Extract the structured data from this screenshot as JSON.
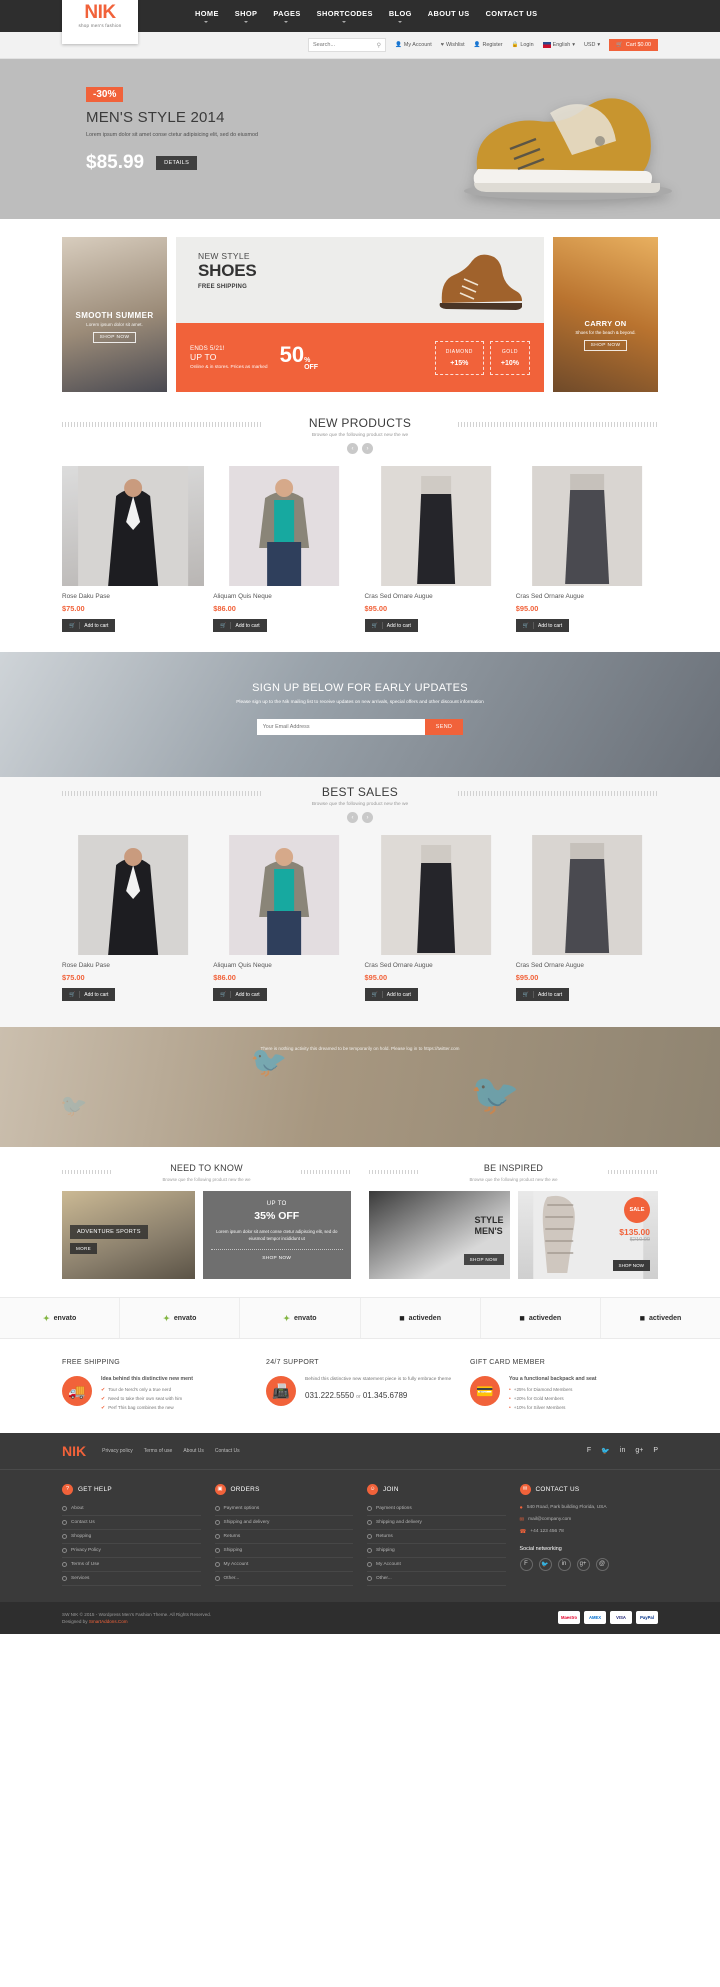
{
  "header": {
    "logo": "NIK",
    "logo_sub": "shop men's fashion",
    "nav": [
      {
        "label": "HOME",
        "caret": true
      },
      {
        "label": "SHOP",
        "caret": true
      },
      {
        "label": "PAGES",
        "caret": true
      },
      {
        "label": "SHORTCODES",
        "caret": true
      },
      {
        "label": "BLOG",
        "caret": true
      },
      {
        "label": "ABOUT US",
        "caret": false
      },
      {
        "label": "CONTACT US",
        "caret": false
      }
    ]
  },
  "utilitybar": {
    "search_placeholder": "Search...",
    "search_value": "",
    "search_icon": "search-icon",
    "my_account": "My Account",
    "wishlist": "Wishlist",
    "register": "Register",
    "login": "Login",
    "language": "English",
    "currency": "USD",
    "cart": "Cart $0.00"
  },
  "hero": {
    "badge": "-30%",
    "title": "MEN'S STYLE 2014",
    "desc": "Lorem ipsum dolor sit amet conse ctetur adipisicing elit, sed do eiusmod",
    "price": "$85.99",
    "button": "DETAILS"
  },
  "promos": {
    "left": {
      "title": "SMOOTH SUMMER",
      "sub": "Lorem ipsum dolor sit amet.",
      "cta": "SHOP NOW"
    },
    "mid": {
      "small": "NEW STYLE",
      "big": "SHOES",
      "shipping": "FREE SHIPPING",
      "ends": "ENDS 5/21!",
      "upto": "UP TO",
      "percent": "50",
      "pct_sym": "%",
      "off": "OFF",
      "fine": "Online & in stores. Prices as marked",
      "tiers": [
        {
          "name": "DIAMOND",
          "value": "+15%"
        },
        {
          "name": "GOLD",
          "value": "+10%"
        }
      ]
    },
    "right": {
      "title": "CARRY ON",
      "sub": "Shoes for the beach & beyond.",
      "cta": "SHOP NOW"
    }
  },
  "new_products": {
    "title": "NEW PRODUCTS",
    "subtitle": "Browse que the following product new the we",
    "prev": "‹",
    "next": "›",
    "add_to_cart": "Add to cart",
    "items": [
      {
        "name": "Rose Daku Pase",
        "price": "$75.00"
      },
      {
        "name": "Aliquam Quis Neque",
        "price": "$86.00"
      },
      {
        "name": "Cras Sed Ornare Augue",
        "price": "$95.00"
      },
      {
        "name": "Cras Sed Ornare Augue",
        "price": "$95.00"
      }
    ]
  },
  "newsletter": {
    "title": "SIGN UP BELOW FOR EARLY UPDATES",
    "desc": "Please sign up to the Nik mailing list to receive updates on new arrivals, special offers and other discount information",
    "placeholder": "Your Email Address",
    "value": "",
    "button": "SEND"
  },
  "best_sales": {
    "title": "BEST SALES",
    "subtitle": "Browse que the following product new the we",
    "prev": "‹",
    "next": "›",
    "add_to_cart": "Add to cart",
    "items": [
      {
        "name": "Rose Daku Pase",
        "price": "$75.00"
      },
      {
        "name": "Aliquam Quis Neque",
        "price": "$86.00"
      },
      {
        "name": "Cras Sed Ornare Augue",
        "price": "$95.00"
      },
      {
        "name": "Cras Sed Ornare Augue",
        "price": "$95.00"
      }
    ]
  },
  "twitter_strip": {
    "text": "There is nothing activity this dreamed to be temporarily on hold. Please log in to https://twitter.com"
  },
  "need_to_know": {
    "title": "NEED TO KNOW",
    "subtitle": "Browse que the following product new the we",
    "card1": {
      "tag": "ADVENTURE SPORTS",
      "more": "MORE"
    },
    "card2": {
      "upto": "UP TO",
      "percent": "35% OFF",
      "desc": "Lorem ipsum dolor sit amet conse ctetur adipiscing elit, sed do eiusmod tempor incididunt ut",
      "cta": "SHOP NOW"
    }
  },
  "be_inspired": {
    "title": "BE INSPIRED",
    "subtitle": "Browse que the following product new the we",
    "card3": {
      "line1": "STYLE",
      "line2": "MEN'S",
      "cta": "SHOP NOW"
    },
    "card4": {
      "badge": "SALE",
      "price": "$135.00",
      "old_price": "$210.00",
      "cta": "SHOP NOW"
    }
  },
  "brands": [
    {
      "name": "envato",
      "icon": "leaf-icon"
    },
    {
      "name": "envato",
      "icon": "leaf-icon"
    },
    {
      "name": "envato",
      "icon": "leaf-icon"
    },
    {
      "name": "activeden",
      "icon": "square-icon"
    },
    {
      "name": "activeden",
      "icon": "square-icon"
    },
    {
      "name": "activeden",
      "icon": "square-icon"
    }
  ],
  "services": [
    {
      "heading": "FREE SHIPPING",
      "icon": "truck-icon",
      "lead": "Idea behind this distinctive new ment",
      "items": [
        "Tour de Nerd's only a true nerd",
        "Need to take their own seat with him",
        "Perf This bag combines the new"
      ]
    },
    {
      "heading": "24/7 SUPPORT",
      "icon": "fax-icon",
      "desc": "Behind this distinctive new statement piece is to fully embrace theme",
      "phone": "031.222.5550",
      "phone_or": "or",
      "phone2": "01.345.6789"
    },
    {
      "heading": "GIFT CARD MEMBER",
      "icon": "credit-card-icon",
      "lead": "You a functional backpack and seat",
      "items": [
        "+25% for Diamond Members",
        "+20% for Gold Members",
        "+10% for Silver Members"
      ]
    }
  ],
  "footer": {
    "logo": "NIK",
    "links": [
      "Privacy policy",
      "Terms of use",
      "About Us",
      "Contact Us"
    ],
    "social_top": [
      "facebook-icon",
      "twitter-icon",
      "linkedin-icon",
      "google-plus-icon",
      "pinterest-icon"
    ],
    "columns": [
      {
        "title": "GET HELP",
        "icon": "help-icon",
        "items": [
          "About",
          "Contact Us",
          "Shopping",
          "Privacy Policy",
          "Terms of Use",
          "Services"
        ]
      },
      {
        "title": "ORDERS",
        "icon": "orders-icon",
        "items": [
          "Payment options",
          "Shipping and delivery",
          "Returns",
          "Shipping",
          "My Account",
          "Other..."
        ]
      },
      {
        "title": "JOIN",
        "icon": "join-icon",
        "items": [
          "Payment options",
          "Shipping and delivery",
          "Returns",
          "Shipping",
          "My Account",
          "Other..."
        ]
      }
    ],
    "contact": {
      "title": "CONTACT US",
      "icon": "mail-icon",
      "address": "540 Road, Park building Florida, USA",
      "email": "mail@company.com",
      "phone": "+44 123 456 78",
      "social_heading": "Social networking",
      "social": [
        "facebook-icon",
        "twitter-icon",
        "linkedin-icon",
        "google-plus-icon",
        "pinterest-icon"
      ]
    },
    "copyright": "SW NIK © 2015 - Wordpress Men's Fashion Theme. All Rights Reserved.",
    "credit_pre": "Designed by",
    "credit_link": "SmartAddons.Com",
    "payments": [
      "Maestro",
      "AMEX",
      "VISA",
      "PayPal"
    ]
  }
}
